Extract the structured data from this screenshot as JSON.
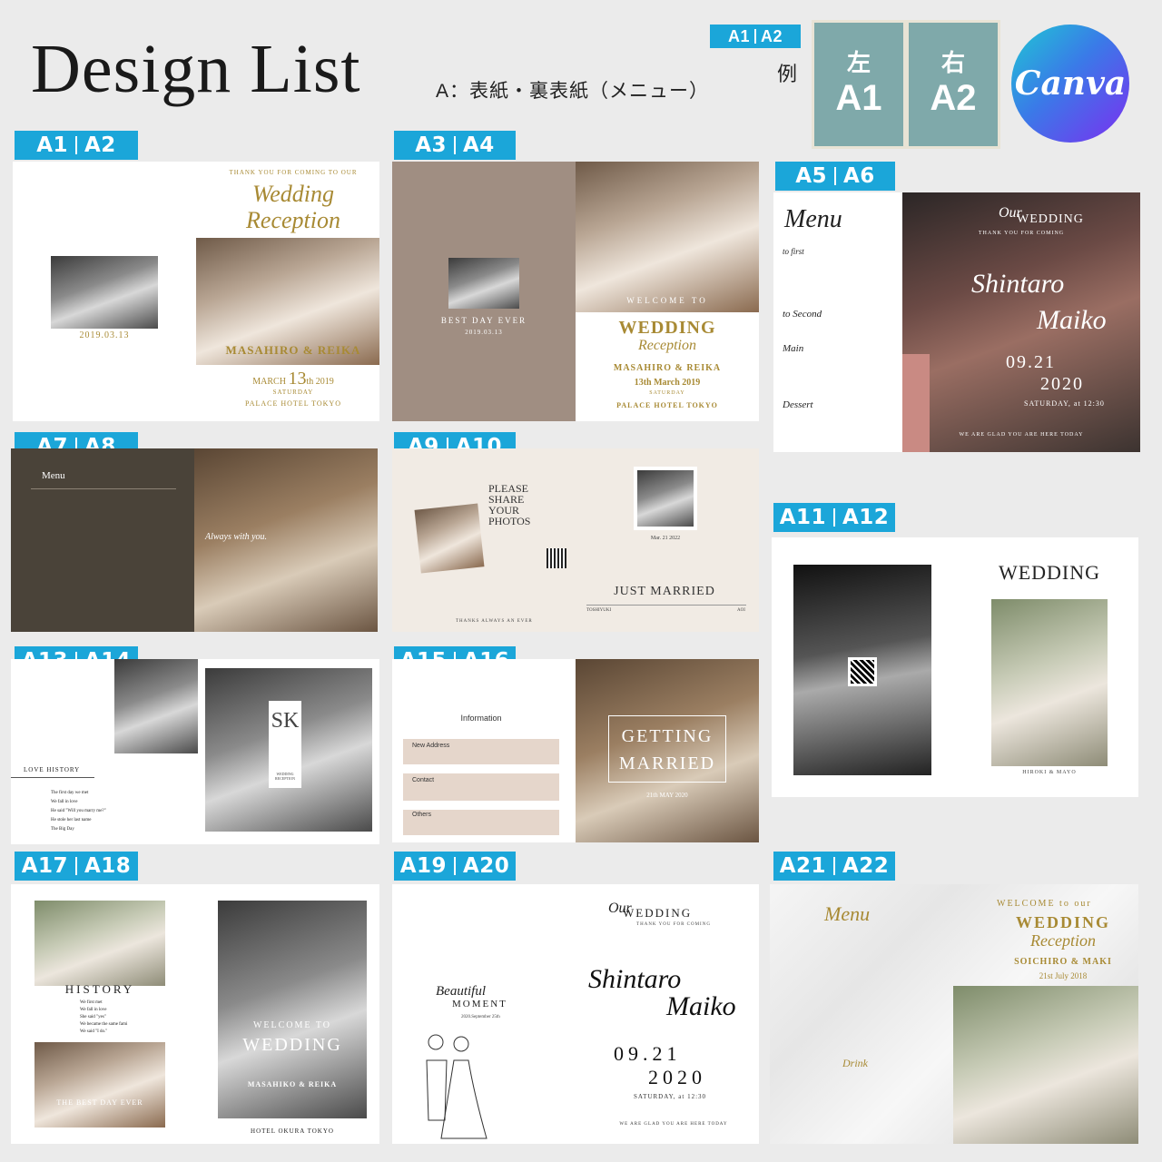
{
  "header": {
    "title": "Design List",
    "subtitle": "A：表紙・裏表紙（メニュー）",
    "legend": {
      "left_code": "A1",
      "right_code": "A2",
      "label": "例"
    },
    "example": {
      "left_label": "左",
      "left_code": "A1",
      "right_label": "右",
      "right_code": "A2"
    },
    "canva_logo": "Canva"
  },
  "designs": [
    {
      "left": "A1",
      "right": "A2",
      "texts": {
        "date": "2019.03.13",
        "top": "THANK YOU FOR COMING TO OUR",
        "script": "Wedding Reception",
        "names": "MASAHIRO & REIKA",
        "month": "MARCH",
        "day": "13",
        "th": "th",
        "year": "2019",
        "weekday": "SATURDAY",
        "venue": "PALACE HOTEL TOKYO"
      }
    },
    {
      "left": "A3",
      "right": "A4",
      "texts": {
        "best": "BEST DAY EVER",
        "date": "2019.03.13",
        "welcome": "WELCOME TO",
        "big": "WEDDING",
        "script": "Reception",
        "names": "MASAHIRO & REIKA",
        "when": "13th March 2019",
        "weekday": "SATURDAY",
        "venue": "PALACE HOTEL TOKYO"
      }
    },
    {
      "left": "A5",
      "right": "A6",
      "texts": {
        "menu": "Menu",
        "first": "to first",
        "second": "to Second",
        "main": "Main",
        "dessert": "Dessert",
        "our": "Our",
        "wedding": "WEDDING",
        "thanks": "THANK YOU FOR COMING",
        "name1": "Shintaro",
        "name2": "Maiko",
        "date1": "09.21",
        "date2": "2020",
        "time": "SATURDAY, at 12:30",
        "bottom": "WE ARE GLAD YOU ARE HERE TODAY"
      }
    },
    {
      "left": "A7",
      "right": "A8",
      "texts": {
        "menu": "Menu",
        "script": "Always with you."
      }
    },
    {
      "left": "A9",
      "right": "A10",
      "texts": {
        "please": "PLEASE SHARE YOUR PHOTOS",
        "date": "Mar. 21 2022",
        "just": "JUST MARRIED",
        "thanks": "THANKS ALWAYS AN EVER",
        "name1": "TOSHIYUKI",
        "name2": "AOI"
      }
    },
    {
      "left": "A11",
      "right": "A12",
      "texts": {
        "wedding": "WEDDING",
        "names": "HIROKI & MAYO"
      }
    },
    {
      "left": "A13",
      "right": "A14",
      "texts": {
        "history": "LOVE HISTORY",
        "e1": "The first day we met",
        "e2": "We fall in love",
        "e3": "He said \"Will you marry me?\"",
        "e4": "He stole her last name",
        "e5": "The Big Day",
        "mono": "SK",
        "wedding": "WEDDING RECEPTION"
      }
    },
    {
      "left": "A15",
      "right": "A16",
      "texts": {
        "info": "Information",
        "addr": "New Address",
        "contact": "Contact",
        "others": "Others",
        "getting": "GETTING",
        "married": "MARRIED",
        "date": "21th MAY 2020"
      }
    },
    {
      "left": "A17",
      "right": "A18",
      "texts": {
        "history": "HISTORY",
        "e1": "We first met",
        "e2": "We fall in love",
        "e3": "She said \"yes\"",
        "e4": "We became the same fami",
        "e5": "We said \"I do.\"",
        "best": "THE BEST DAY EVER",
        "welcome": "WELCOME TO",
        "wedding": "WEDDING",
        "names": "MASAHIKO & REIKA",
        "venue": "HOTEL OKURA TOKYO"
      }
    },
    {
      "left": "A19",
      "right": "A20",
      "texts": {
        "beautiful": "Beautiful",
        "moment": "MOMENT",
        "msub": "2020.September 25th",
        "our": "Our",
        "wedding": "WEDDING",
        "thanks": "THANK YOU FOR COMING",
        "name1": "Shintaro",
        "name2": "Maiko",
        "date1": "09.21",
        "date2": "2020",
        "time": "SATURDAY, at 12:30",
        "bottom": "WE ARE GLAD YOU ARE HERE TODAY"
      }
    },
    {
      "left": "A21",
      "right": "A22",
      "texts": {
        "menu": "Menu",
        "drink": "Drink",
        "welcome": "WELCOME to our",
        "wedding": "WEDDING",
        "script": "Reception",
        "names": "SOICHIRO & MAKI",
        "date": "21st July 2018"
      }
    }
  ]
}
